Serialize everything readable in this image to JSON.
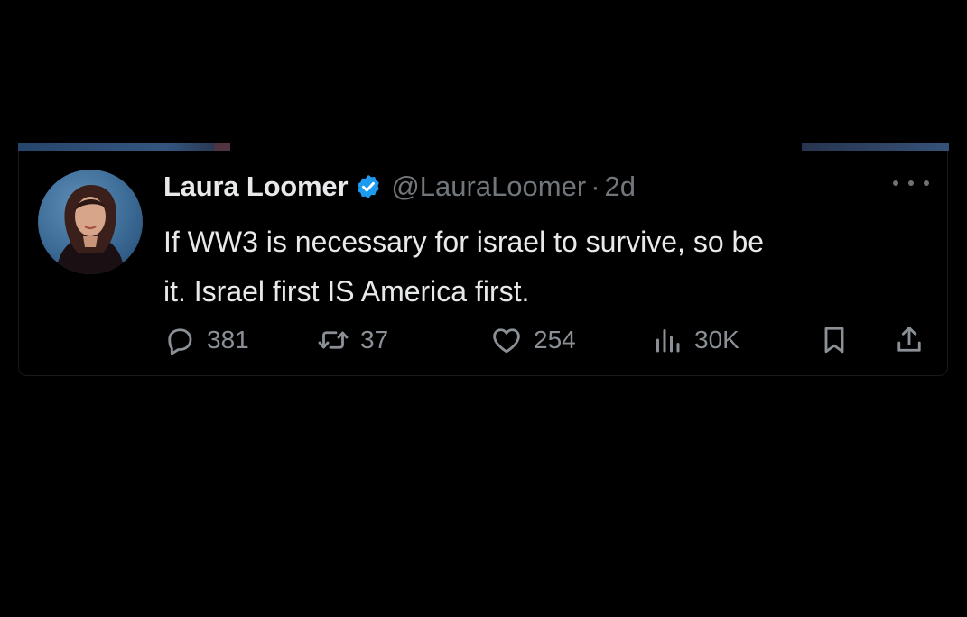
{
  "tweet": {
    "display_name": "Laura Loomer",
    "handle": "@LauraLoomer",
    "separator": "·",
    "time": "2d",
    "text_line1": "If WW3 is necessary for israel to survive, so be",
    "text_line2": "it. Israel first IS America first.",
    "verified_color": "#1d9bf0"
  },
  "actions": {
    "replies": "381",
    "reposts": "37",
    "likes": "254",
    "views": "30K"
  },
  "icons": [
    "verified-badge-icon",
    "more-icon",
    "reply-icon",
    "repost-icon",
    "like-icon",
    "views-icon",
    "bookmark-icon",
    "share-icon"
  ],
  "colors": {
    "background": "#000000",
    "text_primary": "#e7e9ea",
    "text_secondary": "#71767b"
  }
}
